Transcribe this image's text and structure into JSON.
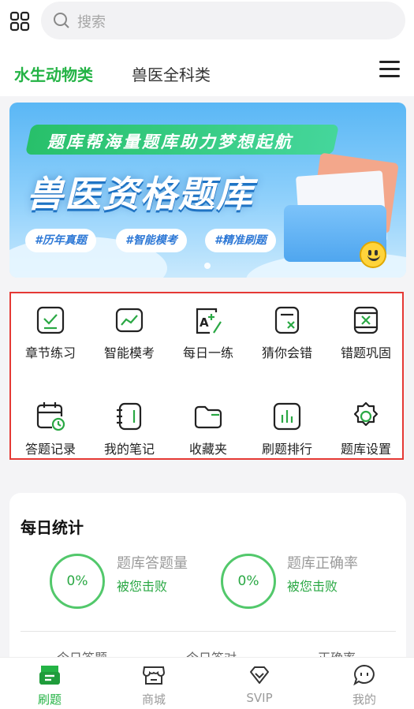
{
  "search": {
    "placeholder": "搜索"
  },
  "tabs": [
    {
      "label": "水生动物类",
      "active": true
    },
    {
      "label": "兽医全科类",
      "active": false
    }
  ],
  "banner": {
    "ribbon": "题库帮海量题库助力梦想起航",
    "title": "兽医资格题库",
    "tags": [
      "#历年真题",
      "#智能模考",
      "#精准刷题"
    ]
  },
  "features": [
    {
      "label": "章节练习",
      "icon": "checklist-icon"
    },
    {
      "label": "智能模考",
      "icon": "trend-chart-icon"
    },
    {
      "label": "每日一练",
      "icon": "a-plus-edit-icon"
    },
    {
      "label": "猜你会错",
      "icon": "doc-x-icon"
    },
    {
      "label": "错题巩固",
      "icon": "error-doc-icon"
    },
    {
      "label": "答题记录",
      "icon": "calendar-clock-icon"
    },
    {
      "label": "我的笔记",
      "icon": "notebook-icon"
    },
    {
      "label": "收藏夹",
      "icon": "folder-icon"
    },
    {
      "label": "刷题排行",
      "icon": "bar-chart-icon"
    },
    {
      "label": "题库设置",
      "icon": "gear-icon"
    }
  ],
  "stats": {
    "title": "每日统计",
    "items": [
      {
        "value": "0%",
        "label": "题库答题量",
        "sub": "被您击败"
      },
      {
        "value": "0%",
        "label": "题库正确率",
        "sub": "被您击败"
      }
    ],
    "small": [
      "今日答题",
      "今日答对",
      "正确率"
    ]
  },
  "nav": [
    {
      "label": "刷题",
      "icon": "practice-icon",
      "active": true
    },
    {
      "label": "商城",
      "icon": "store-icon",
      "active": false
    },
    {
      "label": "SVIP",
      "icon": "diamond-icon",
      "active": false
    },
    {
      "label": "我的",
      "icon": "chat-profile-icon",
      "active": false
    }
  ],
  "colors": {
    "accent": "#24b345",
    "highlight_border": "#e53935"
  }
}
